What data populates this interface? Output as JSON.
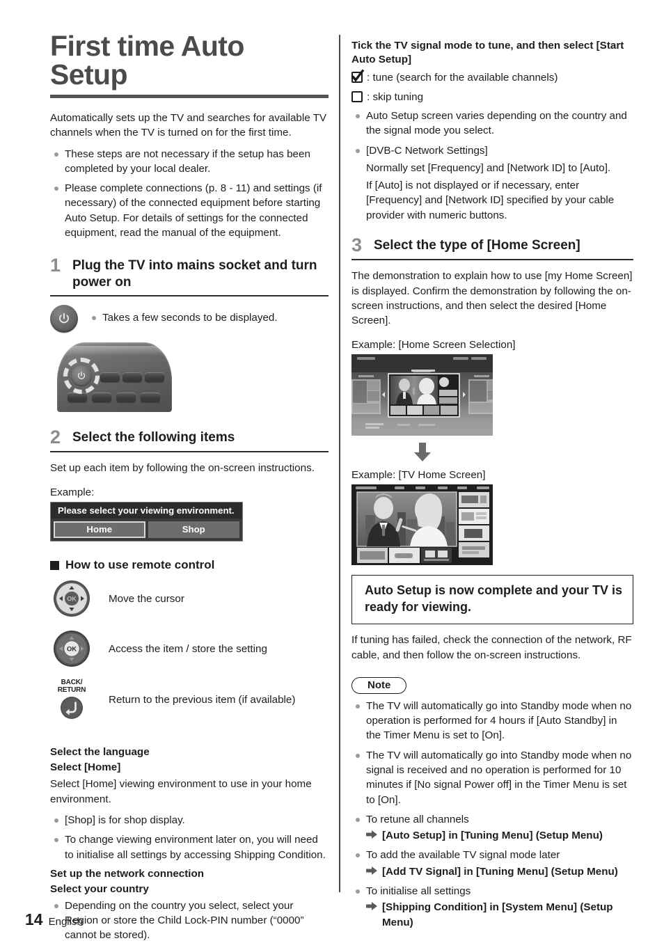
{
  "document": {
    "title": "First time Auto Setup",
    "footer": {
      "page_number": "14",
      "language": "English"
    }
  },
  "left_column": {
    "intro": "Automatically sets up the TV and searches for available TV channels when the TV is turned on for the first time.",
    "intro_bullets": [
      "These steps are not necessary if the setup has been completed by your local dealer.",
      "Please complete connections (p. 8 - 11) and settings (if necessary) of the connected equipment before starting Auto Setup. For details of settings for the connected equipment, read the manual of the equipment."
    ],
    "step1": {
      "number": "1",
      "title": "Plug the TV into mains socket and turn power on",
      "note": "Takes a few seconds to be displayed.",
      "power_icon": "power-icon",
      "remote_icon": "remote-control-illustration"
    },
    "step2": {
      "number": "2",
      "title": "Select the following items",
      "intro": "Set up each item by following the on-screen instructions.",
      "example_label": "Example:",
      "osd": {
        "title": "Please select your viewing environment.",
        "buttons": [
          {
            "label": "Home",
            "selected": true
          },
          {
            "label": "Shop",
            "selected": false
          }
        ]
      },
      "remote_section": {
        "heading": "How to use remote control",
        "keys": [
          {
            "icon": "cursor-pad-icon",
            "label": "Move the cursor"
          },
          {
            "icon": "ok-button-icon",
            "label": "Access the item / store the setting"
          },
          {
            "icon": "back-return-icon",
            "icon_label_line1": "BACK/",
            "icon_label_line2": "RETURN",
            "label": "Return to the previous item (if available)"
          }
        ]
      },
      "settings": {
        "head_language": "Select the language",
        "head_home": "Select [Home]",
        "home_text": "Select [Home] viewing environment to use in your home environment.",
        "home_bullets": [
          "[Shop] is for shop display.",
          "To change viewing environment later on, you will need to initialise all settings by accessing Shipping Condition."
        ],
        "head_network": "Set up the network connection",
        "head_country": "Select your country",
        "country_bullets": [
          "Depending on the country you select, select your Region or store the Child Lock-PIN number (“0000” cannot be stored)."
        ]
      }
    }
  },
  "right_column": {
    "tune_heading": "Tick the TV signal mode to tune, and then select [Start Auto Setup]",
    "checkbox_lines": [
      {
        "icon": "checkbox-checked-icon",
        "checked": true,
        "text": ": tune (search for the available channels)"
      },
      {
        "icon": "checkbox-empty-icon",
        "checked": false,
        "text": ": skip tuning"
      }
    ],
    "tune_bullets": [
      "Auto Setup screen varies depending on the country and the signal mode you select."
    ],
    "dvbc": {
      "label": "[DVB-C Network Settings]",
      "line1": "Normally set [Frequency] and [Network ID] to [Auto].",
      "line2": "If [Auto] is not displayed or if necessary, enter [Frequency] and [Network ID] specified by your cable provider with numeric buttons."
    },
    "step3": {
      "number": "3",
      "title": "Select the type of [Home Screen]",
      "intro": "The demonstration to explain how to use [my Home Screen] is displayed. Confirm the demonstration by following the on-screen instructions, and then select the desired [Home Screen].",
      "example1_label": "Example: [Home Screen Selection]",
      "example1_image": "home-screen-selection-screenshot",
      "arrow_icon": "arrow-down-icon",
      "example2_label": "Example: [TV Home Screen]",
      "example2_image": "tv-home-screen-screenshot"
    },
    "complete_box": "Auto Setup is now complete and your TV is ready for viewing.",
    "tuning_failed": "If tuning has failed, check the connection of the network, RF cable, and then follow the on-screen instructions.",
    "note": {
      "label": "Note",
      "items": [
        {
          "text": "The TV will automatically go into Standby mode when no operation is performed for 4 hours if [Auto Standby] in the Timer Menu is set to [On]."
        },
        {
          "text": "The TV will automatically go into Standby mode when no signal is received and no operation is performed for 10 minutes if [No signal Power off] in the Timer Menu is set to [On]."
        },
        {
          "text": "To retune all channels",
          "arrow": "[Auto Setup] in [Tuning Menu] (Setup Menu)"
        },
        {
          "text": "To add the available TV signal mode later",
          "arrow": "[Add TV Signal] in [Tuning Menu] (Setup Menu)"
        },
        {
          "text": "To initialise all settings",
          "arrow": "[Shipping Condition] in [System Menu] (Setup Menu)"
        }
      ]
    }
  }
}
